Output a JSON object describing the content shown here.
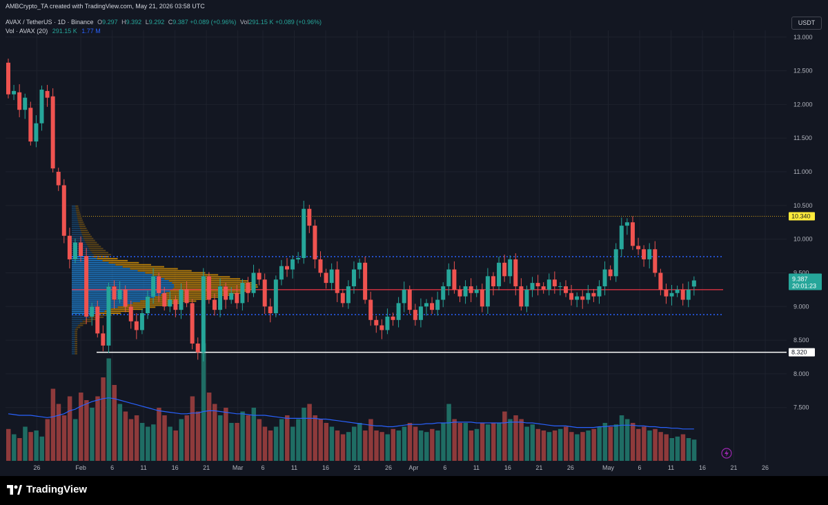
{
  "header": {
    "caption": "AMBCrypto_TA created with TradingView.com, May 21, 2026 03:58 UTC",
    "symbol_line": "AVAX / TetherUS · 1D · Binance",
    "ohlc": {
      "open_label": "O",
      "open": "9.297",
      "high_label": "H",
      "high": "9.392",
      "low_label": "L",
      "low": "9.292",
      "close_label": "C",
      "close": "9.387",
      "change": "+0.089 (+0.96%)",
      "vol_label": "Vol",
      "vol": "291.15 K",
      "vol_change": "+0.089 (+0.96%)"
    },
    "volume_line": {
      "label": "Vol · AVAX (20)",
      "value": "291.15 K",
      "ma": "1.77 M"
    },
    "currency": "USDT"
  },
  "colors": {
    "up": "#26a69a",
    "down": "#ef5350",
    "vol_up": "#1f6d64",
    "vol_down": "#8e3a3b",
    "ma_line": "#2962ff",
    "poc_line": "#f23645",
    "value_area": "#2962ff",
    "profile_up": "#2196f3",
    "profile_down": "#f7a600",
    "support": "#ffffff",
    "resistance_dotted": "#d4a017"
  },
  "chart_data": {
    "type": "candlestick",
    "title": "AVAX / TetherUS · 1D · Binance",
    "x_ticks": [
      "26",
      "Feb",
      "6",
      "11",
      "16",
      "21",
      "Mar",
      "6",
      "11",
      "16",
      "21",
      "26",
      "Apr",
      "6",
      "11",
      "16",
      "21",
      "26",
      "May",
      "6",
      "11",
      "16",
      "21",
      "26"
    ],
    "y_ticks": [
      "13.000",
      "12.500",
      "12.000",
      "11.500",
      "11.000",
      "10.500",
      "10.000",
      "9.500",
      "9.000",
      "8.500",
      "8.000",
      "7.500"
    ],
    "ylim": [
      7.2,
      13.1
    ],
    "levels": {
      "resistance_dotted": 10.34,
      "value_area_high": 9.74,
      "poc": 9.25,
      "value_area_low": 8.88,
      "support": 8.32
    },
    "price_tags": {
      "resistance": "10.340",
      "last_price": "9.387",
      "countdown": "20:01:23",
      "support": "8.320"
    },
    "candles": [
      [
        12.62,
        12.15
      ],
      [
        12.15,
        12.2
      ],
      [
        12.18,
        11.92
      ],
      [
        11.92,
        12.1
      ],
      [
        11.95,
        11.45
      ],
      [
        11.45,
        11.72
      ],
      [
        11.72,
        12.22
      ],
      [
        12.2,
        12.1
      ],
      [
        12.12,
        11.05
      ],
      [
        11.0,
        10.8
      ],
      [
        10.8,
        10.05
      ],
      [
        10.05,
        9.7
      ],
      [
        9.7,
        9.95
      ],
      [
        9.95,
        9.75
      ],
      [
        9.75,
        8.85
      ],
      [
        8.85,
        9.0
      ],
      [
        9.0,
        8.6
      ],
      [
        8.6,
        8.42
      ],
      [
        8.42,
        9.3
      ],
      [
        9.3,
        9.1
      ],
      [
        9.1,
        9.25
      ],
      [
        9.25,
        9.0
      ],
      [
        9.0,
        8.78
      ],
      [
        8.78,
        8.65
      ],
      [
        8.65,
        8.9
      ],
      [
        8.9,
        9.15
      ],
      [
        9.15,
        9.45
      ],
      [
        9.45,
        9.2
      ],
      [
        9.2,
        9.0
      ],
      [
        9.0,
        9.1
      ],
      [
        9.1,
        8.95
      ],
      [
        8.95,
        9.25
      ],
      [
        9.25,
        9.05
      ],
      [
        9.05,
        8.45
      ],
      [
        8.45,
        8.32
      ],
      [
        8.32,
        9.45
      ],
      [
        9.45,
        9.1
      ],
      [
        9.1,
        8.95
      ],
      [
        8.95,
        9.3
      ],
      [
        9.3,
        9.1
      ],
      [
        9.1,
        9.2
      ],
      [
        9.2,
        9.05
      ],
      [
        9.05,
        9.35
      ],
      [
        9.35,
        9.2
      ],
      [
        9.2,
        9.5
      ],
      [
        9.5,
        9.4
      ],
      [
        9.4,
        9.0
      ],
      [
        9.0,
        8.9
      ],
      [
        8.9,
        9.4
      ],
      [
        9.4,
        9.6
      ],
      [
        9.6,
        9.55
      ],
      [
        9.55,
        9.7
      ],
      [
        9.7,
        9.72
      ],
      [
        9.72,
        10.45
      ],
      [
        10.45,
        10.2
      ],
      [
        10.2,
        9.7
      ],
      [
        9.7,
        9.5
      ],
      [
        9.5,
        9.35
      ],
      [
        9.35,
        9.55
      ],
      [
        9.55,
        9.2
      ],
      [
        9.2,
        9.05
      ],
      [
        9.05,
        9.3
      ],
      [
        9.3,
        9.55
      ],
      [
        9.55,
        9.65
      ],
      [
        9.65,
        9.1
      ],
      [
        9.1,
        8.8
      ],
      [
        8.8,
        8.72
      ],
      [
        8.72,
        8.65
      ],
      [
        8.65,
        8.85
      ],
      [
        8.85,
        8.8
      ],
      [
        8.8,
        9.05
      ],
      [
        9.05,
        9.25
      ],
      [
        9.25,
        8.95
      ],
      [
        8.95,
        8.8
      ],
      [
        8.8,
        9.0
      ],
      [
        9.0,
        9.05
      ],
      [
        9.05,
        8.95
      ],
      [
        8.95,
        9.1
      ],
      [
        9.1,
        9.3
      ],
      [
        9.3,
        9.55
      ],
      [
        9.55,
        9.25
      ],
      [
        9.25,
        9.15
      ],
      [
        9.15,
        9.3
      ],
      [
        9.3,
        9.2
      ],
      [
        9.2,
        9.25
      ],
      [
        9.25,
        9.0
      ],
      [
        9.0,
        9.45
      ],
      [
        9.45,
        9.3
      ],
      [
        9.3,
        9.65
      ],
      [
        9.65,
        9.45
      ],
      [
        9.45,
        9.7
      ],
      [
        9.7,
        9.3
      ],
      [
        9.3,
        9.0
      ],
      [
        9.0,
        9.25
      ],
      [
        9.25,
        9.35
      ],
      [
        9.35,
        9.3
      ],
      [
        9.3,
        9.25
      ],
      [
        9.25,
        9.4
      ],
      [
        9.4,
        9.3
      ],
      [
        9.3,
        9.3
      ],
      [
        9.3,
        9.2
      ],
      [
        9.2,
        9.1
      ],
      [
        9.1,
        9.15
      ],
      [
        9.15,
        9.1
      ],
      [
        9.1,
        9.2
      ],
      [
        9.2,
        9.15
      ],
      [
        9.15,
        9.3
      ],
      [
        9.3,
        9.55
      ],
      [
        9.55,
        9.45
      ],
      [
        9.45,
        9.85
      ],
      [
        9.85,
        10.2
      ],
      [
        10.2,
        10.25
      ],
      [
        10.25,
        9.9
      ],
      [
        9.9,
        9.85
      ],
      [
        9.85,
        9.7
      ],
      [
        9.7,
        9.85
      ],
      [
        9.85,
        9.5
      ],
      [
        9.5,
        9.25
      ],
      [
        9.25,
        9.15
      ],
      [
        9.15,
        9.2
      ],
      [
        9.2,
        9.25
      ],
      [
        9.25,
        9.1
      ],
      [
        9.1,
        9.25
      ],
      [
        9.297,
        9.387
      ]
    ],
    "volumes": [
      0.42,
      0.35,
      0.3,
      0.45,
      0.38,
      0.4,
      0.32,
      0.55,
      0.95,
      0.75,
      0.6,
      0.85,
      0.55,
      0.9,
      0.8,
      0.7,
      0.85,
      1.1,
      1.35,
      1.0,
      0.75,
      0.65,
      0.55,
      0.6,
      0.5,
      0.45,
      0.48,
      0.7,
      0.6,
      0.45,
      0.4,
      0.55,
      0.6,
      0.85,
      0.65,
      1.55,
      0.9,
      0.75,
      0.6,
      0.7,
      0.5,
      0.5,
      0.65,
      0.6,
      0.7,
      0.55,
      0.45,
      0.4,
      0.45,
      0.55,
      0.6,
      0.45,
      0.55,
      0.7,
      0.75,
      0.6,
      0.55,
      0.5,
      0.45,
      0.4,
      0.35,
      0.38,
      0.45,
      0.5,
      0.4,
      0.55,
      0.4,
      0.38,
      0.35,
      0.42,
      0.4,
      0.45,
      0.5,
      0.45,
      0.4,
      0.38,
      0.42,
      0.4,
      0.5,
      0.75,
      0.55,
      0.5,
      0.5,
      0.4,
      0.42,
      0.5,
      0.48,
      0.5,
      0.5,
      0.65,
      0.55,
      0.6,
      0.55,
      0.45,
      0.48,
      0.42,
      0.4,
      0.38,
      0.4,
      0.42,
      0.45,
      0.38,
      0.35,
      0.38,
      0.4,
      0.42,
      0.45,
      0.5,
      0.45,
      0.48,
      0.6,
      0.55,
      0.5,
      0.42,
      0.45,
      0.4,
      0.42,
      0.38,
      0.35,
      0.3,
      0.32,
      0.35,
      0.3,
      0.28
    ],
    "volume_ma": [
      0.62,
      0.61,
      0.6,
      0.6,
      0.6,
      0.59,
      0.58,
      0.57,
      0.58,
      0.6,
      0.62,
      0.66,
      0.68,
      0.72,
      0.75,
      0.78,
      0.8,
      0.82,
      0.83,
      0.82,
      0.8,
      0.78,
      0.76,
      0.74,
      0.72,
      0.7,
      0.68,
      0.66,
      0.65,
      0.64,
      0.63,
      0.62,
      0.62,
      0.63,
      0.63,
      0.65,
      0.66,
      0.66,
      0.65,
      0.64,
      0.63,
      0.62,
      0.62,
      0.61,
      0.6,
      0.6,
      0.6,
      0.59,
      0.58,
      0.57,
      0.56,
      0.56,
      0.56,
      0.56,
      0.56,
      0.56,
      0.55,
      0.55,
      0.54,
      0.53,
      0.52,
      0.51,
      0.5,
      0.49,
      0.48,
      0.47,
      0.46,
      0.46,
      0.45,
      0.45,
      0.46,
      0.47,
      0.48,
      0.48,
      0.48,
      0.49,
      0.49,
      0.5,
      0.5,
      0.5,
      0.51,
      0.51,
      0.51,
      0.51,
      0.5,
      0.5,
      0.5,
      0.5,
      0.5,
      0.5,
      0.51,
      0.51,
      0.51,
      0.5,
      0.5,
      0.49,
      0.48,
      0.47,
      0.46,
      0.46,
      0.46,
      0.45,
      0.44,
      0.44,
      0.44,
      0.44,
      0.45,
      0.45,
      0.46,
      0.46,
      0.47,
      0.47,
      0.47,
      0.46,
      0.46,
      0.45,
      0.45,
      0.44,
      0.44,
      0.43,
      0.43,
      0.42,
      0.42,
      0.42
    ]
  }
}
